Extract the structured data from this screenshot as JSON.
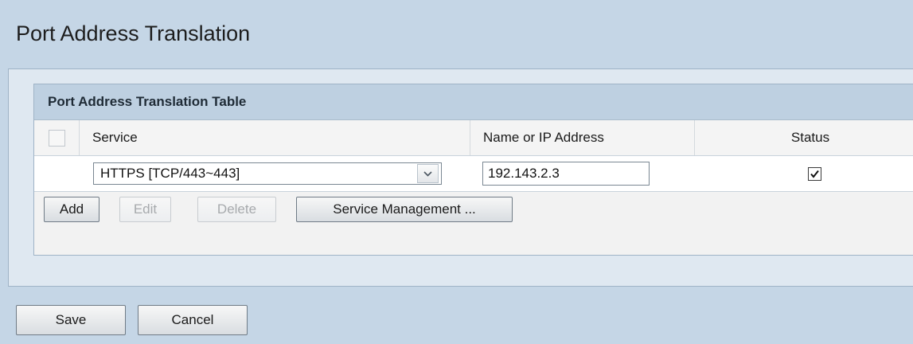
{
  "page": {
    "title": "Port Address Translation"
  },
  "table": {
    "title": "Port Address Translation Table",
    "columns": {
      "service": "Service",
      "name": "Name or IP Address",
      "status": "Status"
    },
    "rows": [
      {
        "service": "HTTPS [TCP/443~443]",
        "name": "192.143.2.3",
        "status_checked": true
      }
    ]
  },
  "table_buttons": {
    "add": "Add",
    "edit": "Edit",
    "delete": "Delete",
    "service_management": "Service Management ..."
  },
  "footer_buttons": {
    "save": "Save",
    "cancel": "Cancel"
  },
  "icons": {
    "dropdown": "chevron-down-icon",
    "check": "checkmark-icon"
  },
  "colors": {
    "background": "#c5d6e6",
    "panel_header": "#bed0e1"
  }
}
